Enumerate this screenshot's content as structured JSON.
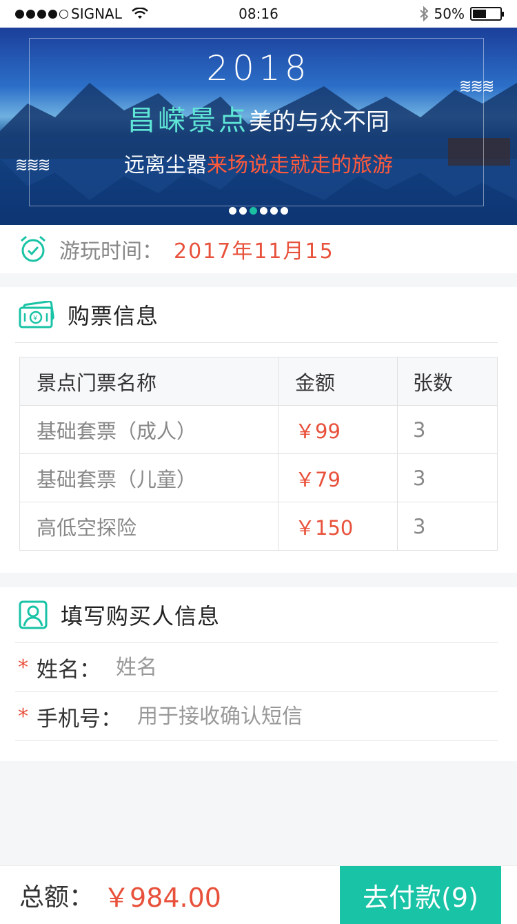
{
  "status_bar": {
    "carrier": "SIGNAL",
    "time": "08:16",
    "battery": "50%",
    "battery_level": 0.5
  },
  "banner": {
    "year": "2018",
    "line2_accent": "昌嵘景点",
    "line2_rest": "美的与众不同",
    "line3_white": "远离尘嚣",
    "line3_red": "来场说走就走的旅游",
    "active_page": 3,
    "page_count": 6
  },
  "visit": {
    "label": "游玩时间：",
    "value": "2017年11月15"
  },
  "tickets": {
    "title": "购票信息",
    "headers": [
      "景点门票名称",
      "金额",
      "张数"
    ],
    "rows": [
      {
        "name": "基础套票（成人）",
        "price": "￥99",
        "qty": "3"
      },
      {
        "name": "基础套票（儿童）",
        "price": "￥79",
        "qty": "3"
      },
      {
        "name": "高低空探险",
        "price": "￥150",
        "qty": "3"
      }
    ]
  },
  "buyer": {
    "title": "填写购买人信息",
    "name_label": "姓名：",
    "name_placeholder": "姓名",
    "phone_label": "手机号：",
    "phone_placeholder": "用于接收确认短信",
    "required_mark": "*"
  },
  "footer": {
    "total_label": "总额：",
    "total_value": "￥984.00",
    "pay_label": "去付款(9)"
  },
  "colors": {
    "accent": "#19c3a6",
    "price": "#e8513b"
  }
}
